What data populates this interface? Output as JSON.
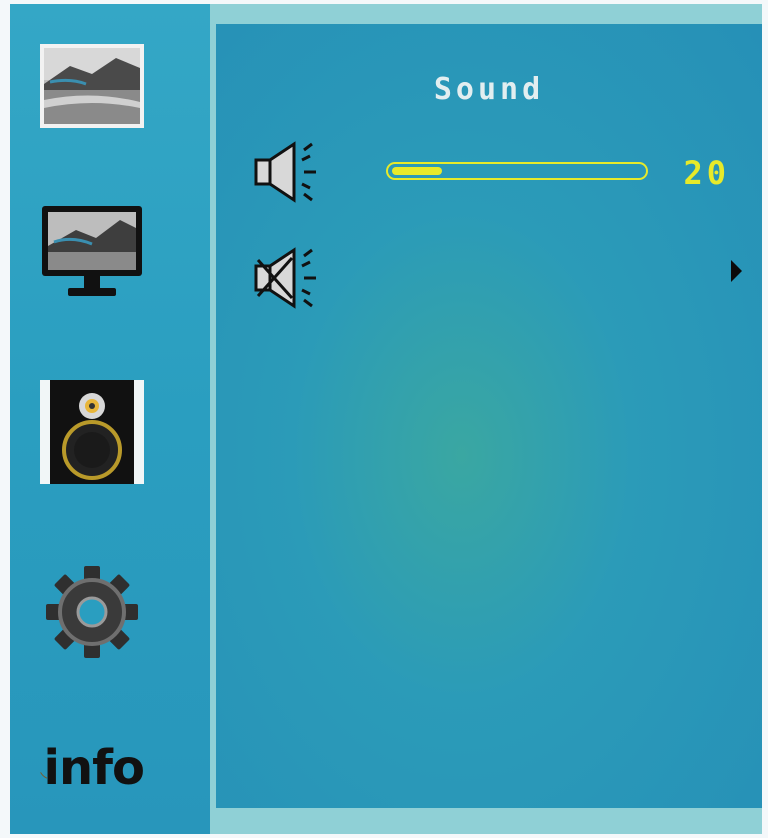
{
  "menu": {
    "title": "Sound",
    "sidebar": [
      {
        "id": "picture",
        "icon": "landscape-photo-icon"
      },
      {
        "id": "display",
        "icon": "monitor-icon"
      },
      {
        "id": "sound",
        "icon": "speaker-icon",
        "selected": true
      },
      {
        "id": "setup",
        "icon": "gear-icon"
      },
      {
        "id": "info",
        "label": "info"
      }
    ],
    "volume": {
      "icon": "volume-icon",
      "value": "20",
      "level_percent": 20
    },
    "mute": {
      "icon": "mute-icon",
      "arrow": "right-arrow-icon"
    }
  },
  "colors": {
    "accent": "#e7ea2a",
    "panel": "#2a99b9",
    "sidebar": "#2ea2c3",
    "title": "#e2eef0"
  }
}
